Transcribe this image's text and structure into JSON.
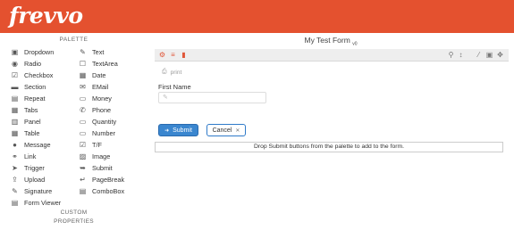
{
  "app": {
    "logo": "frevvo",
    "brand_color": "#e4512f"
  },
  "palette": {
    "title": "PALETTE",
    "left_items": [
      {
        "label": "Dropdown",
        "icon": "dropdown-icon"
      },
      {
        "label": "Radio",
        "icon": "radio-icon"
      },
      {
        "label": "Checkbox",
        "icon": "checkbox-icon"
      },
      {
        "label": "Section",
        "icon": "folder-icon"
      },
      {
        "label": "Repeat",
        "icon": "repeat-icon"
      },
      {
        "label": "Tabs",
        "icon": "tabs-icon"
      },
      {
        "label": "Panel",
        "icon": "panel-icon"
      },
      {
        "label": "Table",
        "icon": "table-icon"
      },
      {
        "label": "Message",
        "icon": "message-icon"
      },
      {
        "label": "Link",
        "icon": "link-icon"
      },
      {
        "label": "Trigger",
        "icon": "trigger-icon"
      },
      {
        "label": "Upload",
        "icon": "upload-icon"
      },
      {
        "label": "Signature",
        "icon": "signature-icon"
      },
      {
        "label": "Form Viewer",
        "icon": "form-viewer-icon"
      }
    ],
    "right_items": [
      {
        "label": "Text",
        "icon": "text-icon"
      },
      {
        "label": "TextArea",
        "icon": "textarea-icon"
      },
      {
        "label": "Date",
        "icon": "calendar-icon"
      },
      {
        "label": "EMail",
        "icon": "email-icon"
      },
      {
        "label": "Money",
        "icon": "money-icon"
      },
      {
        "label": "Phone",
        "icon": "phone-icon"
      },
      {
        "label": "Quantity",
        "icon": "quantity-icon"
      },
      {
        "label": "Number",
        "icon": "number-icon"
      },
      {
        "label": "T/F",
        "icon": "true-false-icon"
      },
      {
        "label": "Image",
        "icon": "image-icon"
      },
      {
        "label": "Submit",
        "icon": "submit-icon"
      },
      {
        "label": "PageBreak",
        "icon": "pagebreak-icon"
      },
      {
        "label": "ComboBox",
        "icon": "combobox-icon"
      }
    ],
    "custom_title_1": "CUSTOM",
    "custom_title_2": "PROPERTIES"
  },
  "form": {
    "title": "My Test Form",
    "version": "v0",
    "toolbar_left_icons": [
      "gear-icon",
      "list-icon",
      "document-icon"
    ],
    "toolbar_right_icons": [
      "search-icon",
      "pin-icon",
      "wand-icon",
      "save-icon",
      "expand-icon"
    ],
    "print_label": "print",
    "field_label": "First Name",
    "field_value": "",
    "submit_label": "Submit",
    "cancel_label": "Cancel",
    "drop_message": "Drop Submit buttons from the palette to add to the form."
  }
}
